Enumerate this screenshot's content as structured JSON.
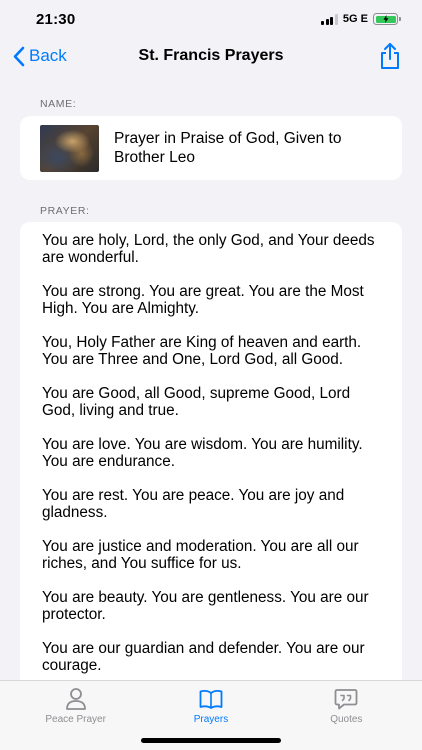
{
  "status": {
    "time": "21:30",
    "network": "5G E"
  },
  "nav": {
    "back_label": "Back",
    "title": "St. Francis Prayers"
  },
  "name_section": {
    "label": "NAME:",
    "value": "Prayer in Praise of God, Given to Brother Leo"
  },
  "prayer_section": {
    "label": "PRAYER:",
    "paragraphs": [
      "You are holy, Lord, the only God, and Your deeds are wonderful.",
      "You are strong. You are great. You are the Most High. You are Almighty.",
      "You, Holy Father are King of heaven and earth. You are Three and One, Lord God, all Good.",
      "You are Good, all Good, supreme Good, Lord God, living and true.",
      "You are love. You are wisdom. You are humility. You are endurance.",
      "You are rest. You are peace. You are joy and gladness.",
      "You are justice and moderation. You are all our riches, and You suffice for us.",
      "You are beauty. You are gentleness. You are our protector.",
      "You are our guardian and defender. You are our courage."
    ]
  },
  "tabs": [
    {
      "label": "Peace Prayer",
      "icon": "person-icon",
      "active": false
    },
    {
      "label": "Prayers",
      "icon": "book-icon",
      "active": true
    },
    {
      "label": "Quotes",
      "icon": "quote-bubble-icon",
      "active": false
    }
  ],
  "colors": {
    "accent": "#007aff",
    "inactive": "#8e8e93",
    "background": "#f2f2f7",
    "battery": "#34c759"
  }
}
